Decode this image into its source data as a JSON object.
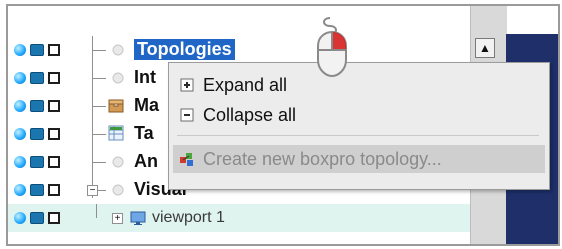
{
  "tree": {
    "rows": [
      {
        "label": "Topologies"
      },
      {
        "label": "Int"
      },
      {
        "label": "Ma"
      },
      {
        "label": "Ta"
      },
      {
        "label": "An"
      },
      {
        "label": "Visual"
      },
      {
        "label": "viewport 1"
      }
    ],
    "expander_minus": "−",
    "expander_plus": "+"
  },
  "context_menu": {
    "items": [
      {
        "label": "Expand all",
        "icon": "expand-icon",
        "enabled": true
      },
      {
        "label": "Collapse all",
        "icon": "collapse-icon",
        "enabled": true
      },
      {
        "label": "Create new boxpro topology...",
        "icon": "create-topology-icon",
        "enabled": false
      }
    ]
  },
  "scrollbar": {
    "up_glyph": "▲"
  },
  "colors": {
    "selection_bg": "#1f66c6",
    "band_bg": "#dff3ef",
    "menu_bg": "#ececec",
    "dark_area": "#1e2f6a"
  }
}
